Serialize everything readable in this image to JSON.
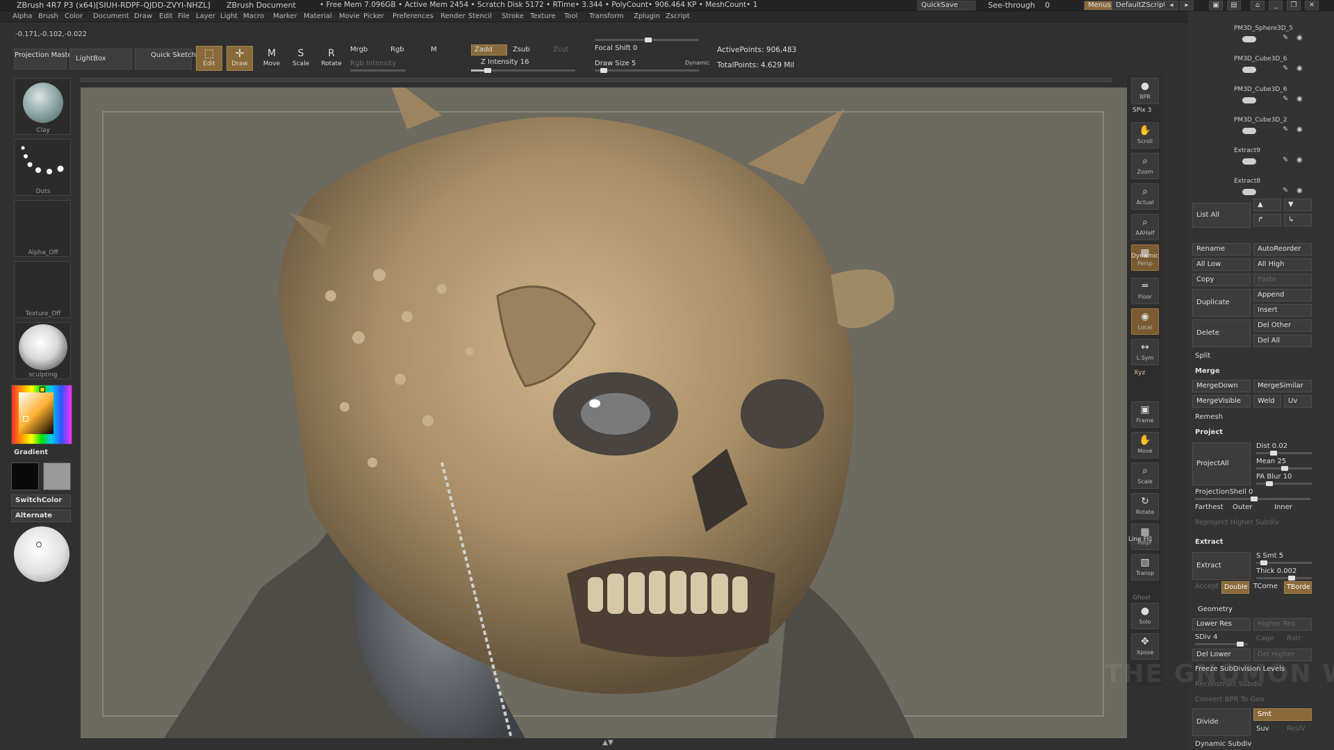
{
  "titlebar": {
    "app": "ZBrush 4R7 P3 (x64)[SIUH-RDPF-QJDD-ZVYI-NHZL]",
    "doc": "ZBrush Document",
    "stats": "• Free Mem 7.096GB • Active Mem 2454 • Scratch Disk 5172 • RTime• 3.344 • PolyCount• 906.464 KP • MeshCount• 1",
    "quicksave": "QuickSave",
    "seethrough": "See-through",
    "seethrough_val": "0",
    "menus": "Menus",
    "defaultzscript": "DefaultZScript"
  },
  "menubar": [
    "Alpha",
    "Brush",
    "Color",
    "Document",
    "Draw",
    "Edit",
    "File",
    "Layer",
    "Light",
    "Macro",
    "Marker",
    "Material",
    "Movie",
    "Picker",
    "Preferences",
    "Render",
    "Stencil",
    "Stroke",
    "Texture",
    "Tool",
    "Transform",
    "Zplugin",
    "Zscript"
  ],
  "coords": "-0.171,-0.102,-0.022",
  "toolbar": {
    "projection_master": "Projection Master",
    "lightbox": "LightBox",
    "quick_sketch": "Quick Sketch",
    "edit": "Edit",
    "draw": "Draw",
    "move": "Move",
    "scale": "Scale",
    "rotate": "Rotate",
    "mrgb": "Mrgb",
    "rgb": "Rgb",
    "m": "M",
    "rgb_intensity": "Rgb Intensity",
    "zadd": "Zadd",
    "zsub": "Zsub",
    "zcut": "Zcut",
    "z_intensity_label": "Z Intensity",
    "z_intensity": 16,
    "focal_shift_label": "Focal Shift",
    "focal_shift": 0,
    "draw_size_label": "Draw Size",
    "draw_size": 5,
    "dynamic": "Dynamic",
    "active_points": "ActivePoints: 906,483",
    "total_points": "TotalPoints: 4.629 Mil"
  },
  "leftpanel": {
    "brush": "Clay",
    "stroke": "Dots",
    "alpha": "Alpha_Off",
    "texture": "Texture_Off",
    "material": "sculpting",
    "gradient": "Gradient",
    "switchcolor": "SwitchColor",
    "alternate": "Alternate"
  },
  "rightstrip": [
    {
      "label": "BPR",
      "icon": "●",
      "name": "bpr"
    },
    {
      "label": "Scroll",
      "icon": "✋",
      "name": "scroll"
    },
    {
      "label": "Zoom",
      "icon": "⌕",
      "name": "zoom"
    },
    {
      "label": "Actual",
      "icon": "⌕",
      "name": "actual"
    },
    {
      "label": "AAHalf",
      "icon": "⌕",
      "name": "aahalf"
    },
    {
      "label": "Persp",
      "icon": "▦",
      "name": "persp"
    },
    {
      "label": "Floor",
      "icon": "═",
      "name": "floor"
    },
    {
      "label": "Local",
      "icon": "◉",
      "name": "local"
    },
    {
      "label": "L.Sym",
      "icon": "↔",
      "name": "lsym"
    },
    {
      "label": "Frame",
      "icon": "▣",
      "name": "frame"
    },
    {
      "label": "Move",
      "icon": "✋",
      "name": "move"
    },
    {
      "label": "Scale",
      "icon": "⌕",
      "name": "scale"
    },
    {
      "label": "Rotate",
      "icon": "↻",
      "name": "rotate"
    },
    {
      "label": "PolyF",
      "icon": "▦",
      "name": "polyf"
    },
    {
      "label": "Transp",
      "icon": "▧",
      "name": "transp"
    },
    {
      "label": "Solo",
      "icon": "●",
      "name": "solo"
    },
    {
      "label": "Xpose",
      "icon": "✥",
      "name": "xpose"
    }
  ],
  "rightstrip_extra": {
    "spix": "SPix 3",
    "dynamic": "Dynamic",
    "xyz": "Xyz",
    "line_fill": "Line Fill",
    "ghost": "Ghost"
  },
  "subtools": [
    "PM3D_Sphere3D_5",
    "PM3D_Cube3D_6",
    "PM3D_Cube3D_6",
    "PM3D_Cube3D_2",
    "Extract9",
    "Extract8"
  ],
  "rightpanel": {
    "list_all": "List All",
    "rename": "Rename",
    "autoreorder": "AutoReorder",
    "all_low": "All Low",
    "all_high": "All High",
    "copy": "Copy",
    "paste": "Paste",
    "duplicate": "Duplicate",
    "append": "Append",
    "insert": "Insert",
    "delete": "Delete",
    "del_other": "Del Other",
    "del_all": "Del All",
    "split": "Split",
    "merge": "Merge",
    "mergedown": "MergeDown",
    "mergesimilar": "MergeSimilar",
    "mergevisible": "MergeVisible",
    "weld": "Weld",
    "uv": "Uv",
    "remesh": "Remesh",
    "project": "Project",
    "projectall": "ProjectAll",
    "dist_label": "Dist",
    "dist": "0.02",
    "mean_label": "Mean",
    "mean": "25",
    "pa_blur_label": "PA Blur",
    "pa_blur": "10",
    "projectionshell_label": "ProjectionShell",
    "projectionshell": "0",
    "farthest": "Farthest",
    "outer": "Outer",
    "inner": "Inner",
    "reproject": "Reproject Higher Subdiv",
    "extract": "Extract",
    "extract_btn": "Extract",
    "s_smt_label": "S Smt",
    "s_smt": "5",
    "thick_label": "Thick",
    "thick": "0.002",
    "accept": "Accept",
    "double": "Double",
    "tcorne": "TCorne",
    "tborde": "TBorde",
    "geometry": "Geometry",
    "lower_res": "Lower Res",
    "higher_res": "Higher Res",
    "sdiv_label": "SDiv",
    "sdiv": "4",
    "cage": "Cage",
    "rstr": "Rstr",
    "del_lower": "Del Lower",
    "del_higher": "Del Higher",
    "freeze": "Freeze SubDivision Levels",
    "reconstruct": "Reconstruct Subdiv",
    "convert_bpr": "Convert BPR To Geo",
    "divide": "Divide",
    "smt": "Smt",
    "suv": "Suv",
    "reuv": "ReUV",
    "dynamic_subdiv": "Dynamic Subdiv"
  },
  "watermark": "THE GNOMON WORKSHOP",
  "colors": {
    "accent": "#8a6a3a",
    "panel": "#333333",
    "canvas": "#6d6a5f",
    "skin": "#b39a72"
  }
}
